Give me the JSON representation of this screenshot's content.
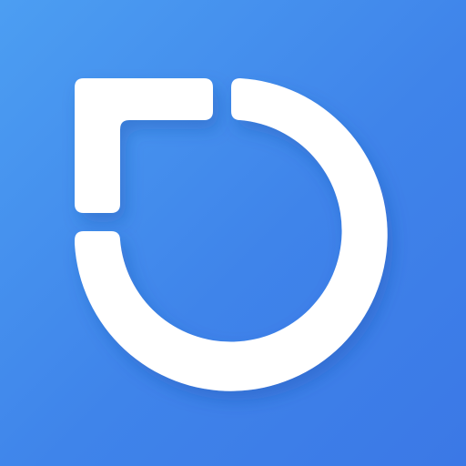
{
  "icon": {
    "name": "app-logo",
    "glyph": "square-corner-and-ring-mark",
    "colors": {
      "background_start": "#4c9ef2",
      "background_end": "#3b78e6",
      "mark": "#ffffff",
      "shadow": "#1f4fa8"
    }
  }
}
